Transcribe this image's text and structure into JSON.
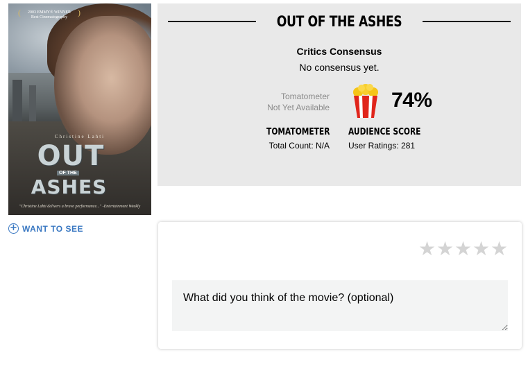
{
  "poster": {
    "emmy_line1": "2003 EMMY® WINNER",
    "emmy_line2": "Best Cinematography",
    "star_name": "Christine Lahti",
    "title_top": "OUT",
    "title_of": "OF THE",
    "title_bottom": "ASHES",
    "quote": "\"Christine Lahti delivers a brave performance...\"",
    "quote_source": "-Entertainment Weekly"
  },
  "want_to_see": {
    "icon": "plus-circle-icon",
    "label": "WANT TO SEE"
  },
  "scores": {
    "movie_title": "OUT OF THE ASHES",
    "critics_consensus_label": "Critics Consensus",
    "critics_consensus_text": "No consensus yet.",
    "tomatometer_status_line1": "Tomatometer",
    "tomatometer_status_line2": "Not Yet Available",
    "audience_icon": "popcorn-icon",
    "audience_percent": "74%",
    "tomatometer_heading": "TOMATOMETER",
    "tomatometer_count": "Total Count: N/A",
    "audience_heading": "AUDIENCE SCORE",
    "audience_count": "User Ratings: 281"
  },
  "review": {
    "stars": [
      "☆",
      "☆",
      "☆",
      "☆",
      "☆"
    ],
    "placeholder": "What did you think of the movie? (optional)"
  },
  "colors": {
    "link_blue": "#3a78c2",
    "panel_bg": "#e9e9e9",
    "popcorn_red": "#e0251b",
    "popcorn_yellow": "#f5c518",
    "star_gray": "#d4d4d4"
  }
}
